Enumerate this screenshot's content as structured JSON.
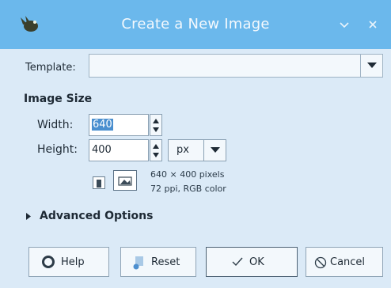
{
  "window": {
    "title": "Create a New Image",
    "app_icon": "wilber-icon",
    "controls": [
      "minimize-chevron-icon",
      "close-icon"
    ]
  },
  "template": {
    "label": "Template:",
    "value": ""
  },
  "image_size": {
    "section_title": "Image Size",
    "width_label": "Width:",
    "width_value": "640",
    "height_label": "Height:",
    "height_value": "400",
    "unit": "px",
    "info_line1": "640 × 400 pixels",
    "info_line2": "72 ppi, RGB color"
  },
  "advanced": {
    "label": "Advanced Options",
    "expanded": false
  },
  "buttons": {
    "help": "Help",
    "reset": "Reset",
    "ok": "OK",
    "cancel": "Cancel"
  },
  "colors": {
    "titlebar": "#6bb8ec",
    "background": "#dbeaf7",
    "selection": "#4a8fcf"
  }
}
